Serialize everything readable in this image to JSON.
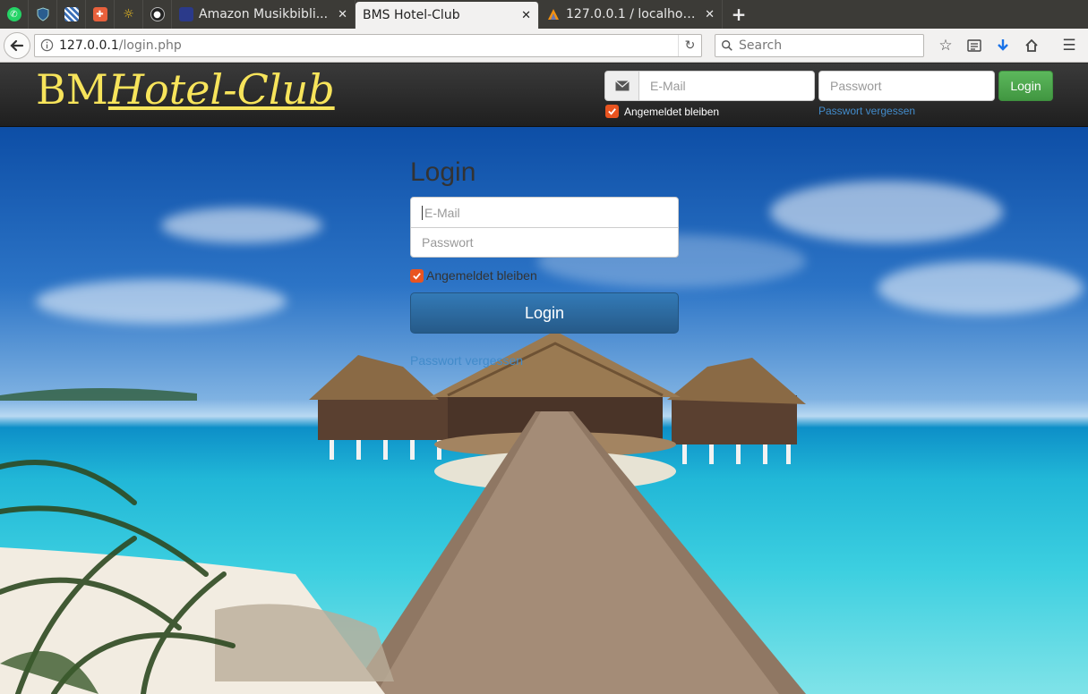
{
  "browser": {
    "tabs": [
      {
        "title": "Amazon Musikbibli...",
        "active": false
      },
      {
        "title": "BMS Hotel-Club",
        "active": true
      },
      {
        "title": "127.0.0.1 / localhost...",
        "active": false
      }
    ],
    "url": {
      "host": "127.0.0.1",
      "path": "/login.php"
    },
    "search_placeholder": "Search"
  },
  "header": {
    "brand_part1": "BM",
    "brand_part2": "Hotel-Club",
    "email_placeholder": "E-Mail",
    "password_placeholder": "Passwort",
    "login_label": "Login",
    "remember_label": "Angemeldet bleiben",
    "forgot_label": "Passwort vergessen"
  },
  "login": {
    "title": "Login",
    "email_placeholder": "E-Mail",
    "password_placeholder": "Passwort",
    "remember_label": "Angemeldet bleiben",
    "button_label": "Login",
    "forgot_label": "Passwort vergessen"
  },
  "colors": {
    "brand": "#f7e45b",
    "header_login": "#5cb85c",
    "primary": "#337ab7",
    "checkbox": "#e95420",
    "link": "#428bca"
  }
}
